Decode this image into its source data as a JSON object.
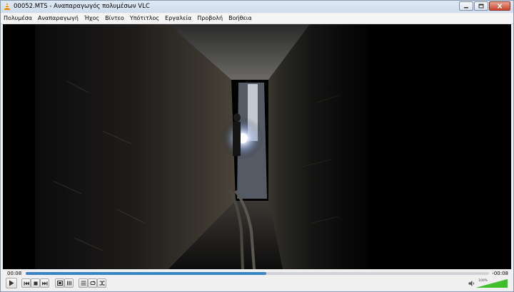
{
  "window": {
    "title": "00052.MTS - Αναπαραγωγός πολυμέσων VLC",
    "buttons": [
      "minimize-icon",
      "maximize-icon",
      "close-icon"
    ]
  },
  "menu": [
    "Πολυμέσα",
    "Αναπαραγωγή",
    "Ήχος",
    "Βίντεο",
    "Υπότιτλος",
    "Εργαλεία",
    "Προβολή",
    "Βοήθεια"
  ],
  "controls": {
    "elapsed": "00:08",
    "remaining": "-00:08",
    "seek_progress": 0.52,
    "volume_label": "100%",
    "volume_level": 1.0,
    "icons": [
      "play-icon",
      "previous-icon",
      "stop-icon",
      "next-icon",
      "fullscreen-icon",
      "extended-settings-icon",
      "playlist-icon",
      "loop-icon",
      "shuffle-icon",
      "volume-icon"
    ]
  },
  "colors": {
    "accent": "#3b83c6",
    "volume": "#3fbf2a",
    "vlc_orange": "#f08a00"
  }
}
